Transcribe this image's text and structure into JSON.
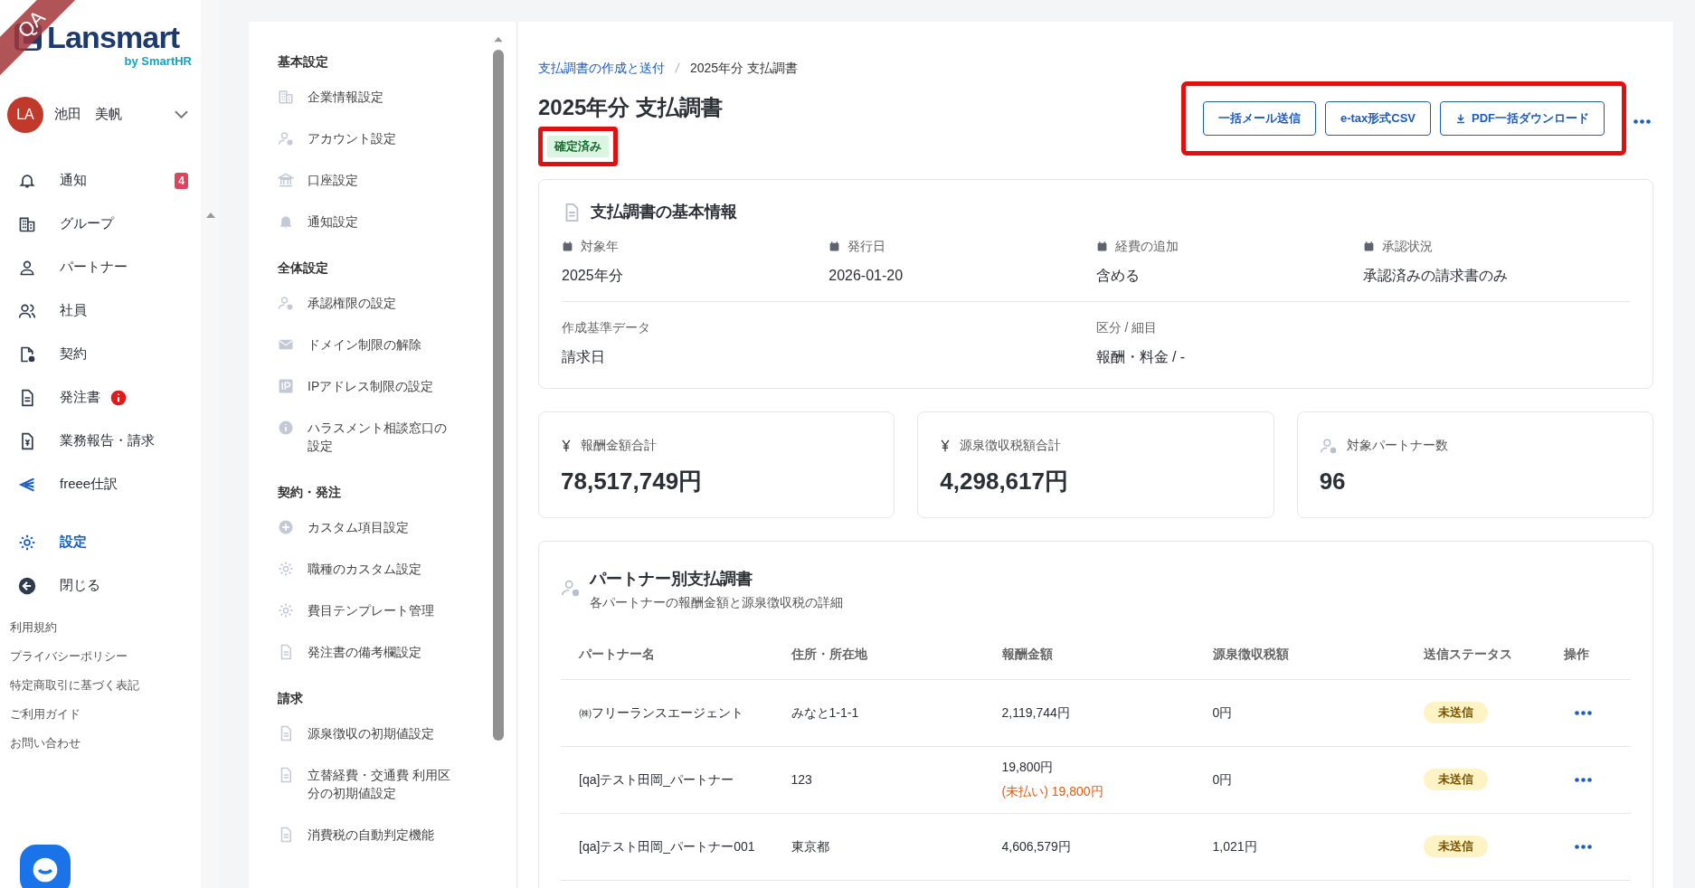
{
  "env_ribbon": "QA",
  "brand": {
    "name": "Lansmart",
    "by": "by SmartHR"
  },
  "user": {
    "initials": "LA",
    "name": "池田　美帆"
  },
  "nav": [
    {
      "label": "通知",
      "selected": false,
      "count": "4",
      "alert": false
    },
    {
      "label": "グループ",
      "selected": false,
      "alert": false
    },
    {
      "label": "パートナー",
      "selected": false,
      "alert": false
    },
    {
      "label": "社員",
      "selected": false,
      "alert": false
    },
    {
      "label": "契約",
      "selected": false,
      "alert": false
    },
    {
      "label": "発注書",
      "selected": false,
      "alert": true
    },
    {
      "label": "業務報告・請求",
      "selected": false,
      "alert": false
    },
    {
      "label": "freee仕訳",
      "selected": false,
      "alert": false
    },
    {
      "label": "設定",
      "selected": true,
      "alert": false
    },
    {
      "label": "閉じる",
      "selected": false,
      "alert": false
    }
  ],
  "footer_links": [
    "利用規約",
    "プライバシーポリシー",
    "特定商取引に基づく表記",
    "ご利用ガイド",
    "お問い合わせ"
  ],
  "settings_menu": [
    {
      "heading": "基本設定",
      "items": [
        "企業情報設定",
        "アカウント設定",
        "口座設定",
        "通知設定"
      ]
    },
    {
      "heading": "全体設定",
      "items": [
        "承認権限の設定",
        "ドメイン制限の解除",
        "IPアドレス制限の設定",
        "ハラスメント相談窓口の設定"
      ]
    },
    {
      "heading": "契約・発注",
      "items": [
        "カスタム項目設定",
        "職種のカスタム設定",
        "費目テンプレート管理",
        "発注書の備考欄設定"
      ]
    },
    {
      "heading": "請求",
      "items": [
        "源泉徴収の初期値設定",
        "立替経費・交通費 利用区分の初期値設定",
        "消費税の自動判定機能"
      ]
    }
  ],
  "breadcrumb": [
    "支払調書の作成と送付",
    "2025年分 支払調書"
  ],
  "page_title": "2025年分 支払調書",
  "status_badge": {
    "label": "確定済み",
    "highlighted": true
  },
  "actions": {
    "highlighted": true,
    "buttons": [
      "一括メール送信",
      "e-tax形式CSV",
      "PDF一括ダウンロード"
    ]
  },
  "basic_info": {
    "title": "支払調書の基本情報",
    "fields": [
      {
        "label": "対象年",
        "value": "2025年分"
      },
      {
        "label": "発行日",
        "value": "2026-01-20"
      },
      {
        "label": "経費の追加",
        "value": "含める"
      },
      {
        "label": "承認状況",
        "value": "承認済みの請求書のみ"
      }
    ],
    "fields_2": [
      {
        "label": "作成基準データ",
        "value": "請求日"
      },
      {
        "label": "区分 / 細目",
        "value": "報酬・料金 / -"
      }
    ]
  },
  "stats": [
    {
      "label": "報酬金額合計",
      "value": "78,517,749円",
      "kind": "yen"
    },
    {
      "label": "源泉徴収税額合計",
      "value": "4,298,617円",
      "kind": "yen"
    },
    {
      "label": "対象パートナー数",
      "value": "96",
      "kind": "people"
    }
  ],
  "partner_table": {
    "title": "パートナー別支払調書",
    "subtitle": "各パートナーの報酬金額と源泉徴収税の詳細",
    "columns": [
      "パートナー名",
      "住所・所在地",
      "報酬金額",
      "源泉徴収税額",
      "送信ステータス",
      "操作"
    ],
    "rows": [
      {
        "name": "㈱フリーランスエージェント",
        "address": "みなと1-1-1",
        "amount": "2,119,744円",
        "tax": "0円",
        "status": "未送信"
      },
      {
        "name": "[qa]テスト田岡_パートナー",
        "address": "123",
        "amount": "19,800円",
        "unpaid": "(未払い) 19,800円",
        "tax": "0円",
        "status": "未送信"
      },
      {
        "name": "[qa]テスト田岡_パートナー001",
        "address": "東京都",
        "amount": "4,606,579円",
        "tax": "1,021円",
        "status": "未送信"
      }
    ]
  }
}
